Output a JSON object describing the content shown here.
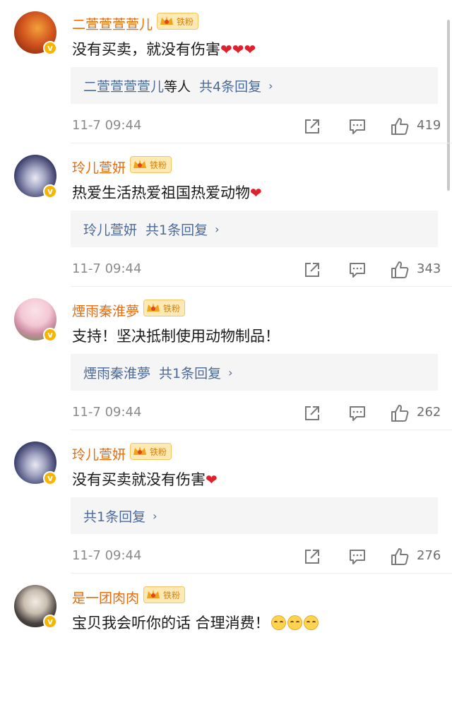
{
  "fan_badge_label": "铁粉",
  "verified_mark": "v",
  "comments": [
    {
      "username": "二萱萱萱萱儿",
      "text": "没有买卖，就没有伤害",
      "trailing_emoji": "❤❤❤",
      "reply_prefix": "二萱萱萱萱儿",
      "reply_mid": "等人",
      "reply_count_label": "共4条回复",
      "reply_chevron": "›",
      "timestamp": "11-7 09:44",
      "likes": "419",
      "avatar_colors": [
        "#b83214",
        "#f2a23a"
      ]
    },
    {
      "username": "玲儿萱妍",
      "text": "热爱生活热爱祖国热爱动物",
      "trailing_emoji": "❤",
      "reply_prefix": "玲儿萱妍",
      "reply_mid": "",
      "reply_count_label": "共1条回复",
      "reply_chevron": "›",
      "timestamp": "11-7 09:44",
      "likes": "343",
      "avatar_colors": [
        "#2b2f5c",
        "#cfd2e6"
      ]
    },
    {
      "username": "煙雨秦淮夢",
      "text": "支持！坚决抵制使用动物制品！",
      "trailing_emoji": "",
      "reply_prefix": "煙雨秦淮夢",
      "reply_mid": "",
      "reply_count_label": "共1条回复",
      "reply_chevron": "›",
      "timestamp": "11-7 09:44",
      "likes": "262",
      "avatar_colors": [
        "#f3c7d4",
        "#6f9a56"
      ]
    },
    {
      "username": "玲儿萱妍",
      "text": "没有买卖就没有伤害",
      "trailing_emoji": "❤",
      "reply_prefix": "",
      "reply_mid": "",
      "reply_count_label": "共1条回复",
      "reply_chevron": "›",
      "timestamp": "11-7 09:44",
      "likes": "276",
      "avatar_colors": [
        "#2b2f5c",
        "#cfd2e6"
      ]
    },
    {
      "username": "是一团肉肉",
      "text": "宝贝我会听你的话 合理消费！",
      "trailing_emoji": "",
      "reply_prefix": "",
      "reply_mid": "",
      "reply_count_label": "",
      "reply_chevron": "",
      "timestamp": "",
      "likes": "",
      "avatar_colors": [
        "#e9e3da",
        "#2a2a2a"
      ]
    }
  ]
}
